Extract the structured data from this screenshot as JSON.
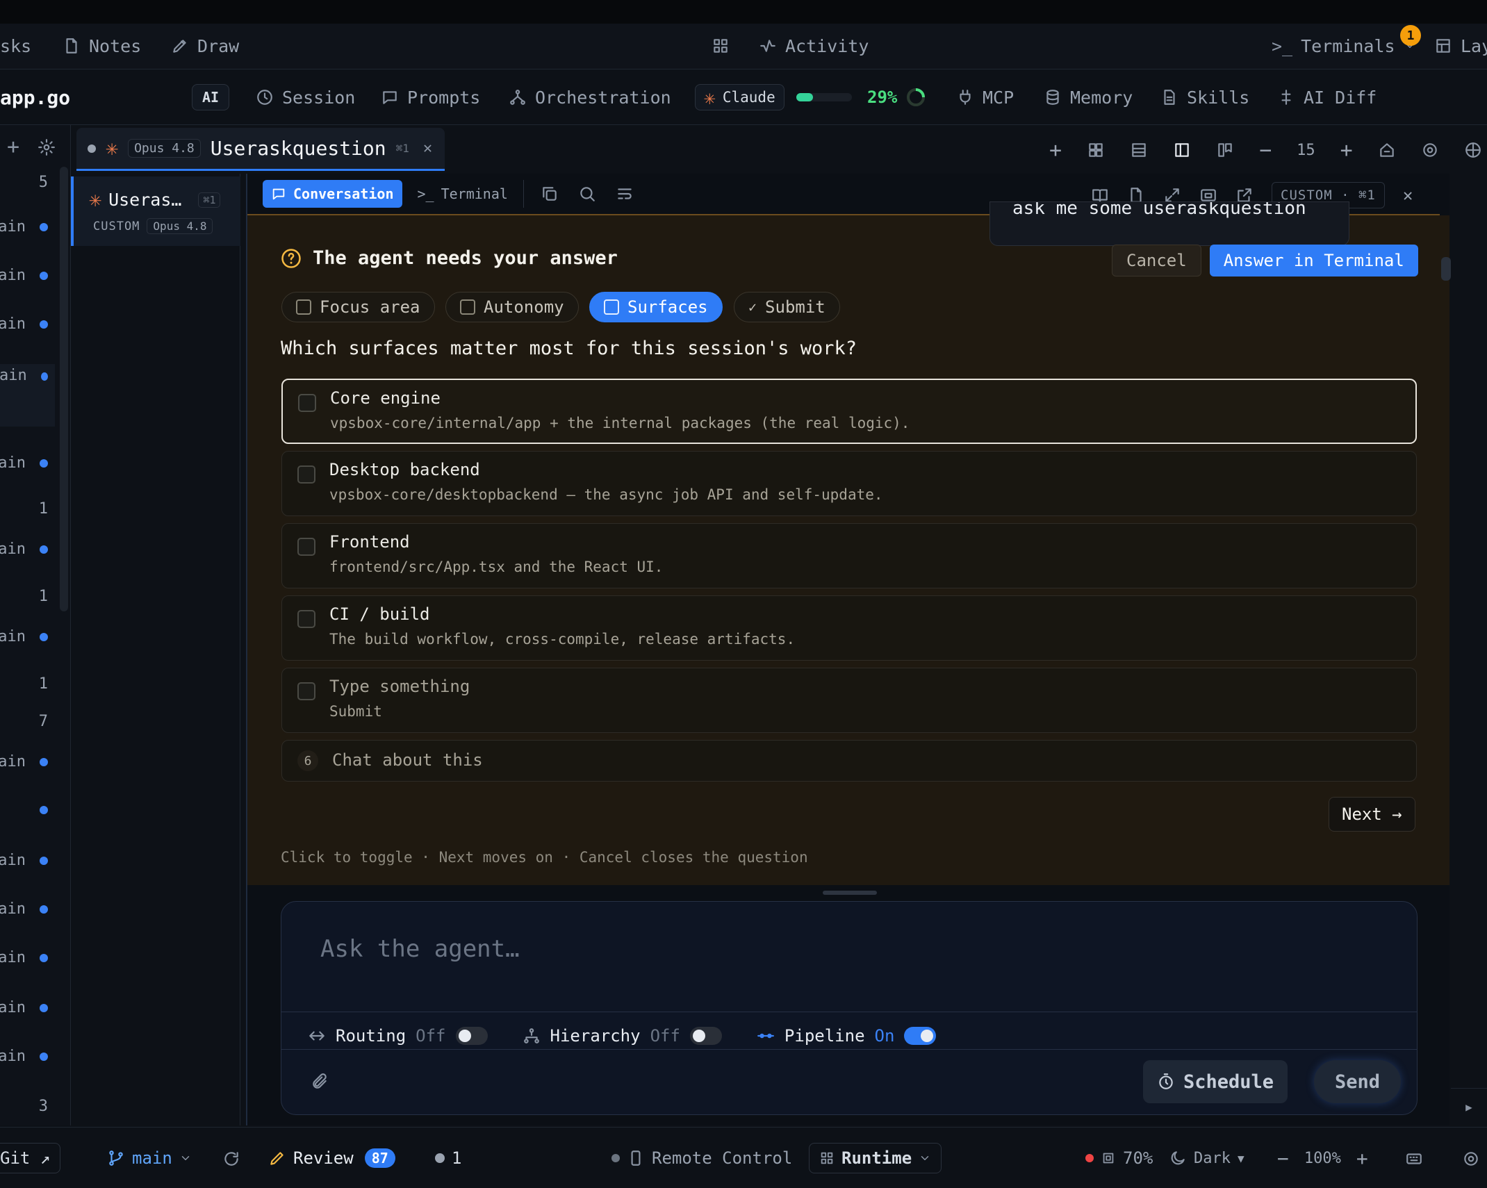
{
  "topnav": {
    "tasks": "sks",
    "notes": "Notes",
    "draw": "Draw",
    "activity": "Activity",
    "terminals": "Terminals",
    "terminals_badge": "1",
    "layout": "Lay"
  },
  "secbar": {
    "file": "app.go",
    "ai": "AI",
    "session": "Session",
    "prompts": "Prompts",
    "orchestration": "Orchestration",
    "claude": "Claude",
    "usage": "29%",
    "mcp": "MCP",
    "memory": "Memory",
    "skills": "Skills",
    "ai_diff": "AI Diff"
  },
  "tab": {
    "model": "Opus 4.8",
    "title": "Useraskquestion",
    "shortcut": "⌘1"
  },
  "toolbar": {
    "zoom": "15"
  },
  "session_card": {
    "title": "Useras…",
    "shortcut": "⌘1",
    "mode": "CUSTOM",
    "model": "Opus 4.8"
  },
  "leftstrip": [
    {
      "label": "5"
    },
    {
      "label": "ain"
    },
    {
      "label": "ain"
    },
    {
      "label": "ain"
    },
    {
      "label": "ain"
    },
    {
      "label": "ain"
    },
    {
      "label": "1"
    },
    {
      "label": "ain"
    },
    {
      "label": "1"
    },
    {
      "label": "ain"
    },
    {
      "label": "1"
    },
    {
      "label": "7"
    },
    {
      "label": "ain"
    },
    {
      "label": ""
    },
    {
      "label": "ain"
    },
    {
      "label": "ain"
    },
    {
      "label": "ain"
    },
    {
      "label": "ain"
    },
    {
      "label": "ain"
    },
    {
      "label": "3"
    }
  ],
  "panel_tabs": {
    "conversation": "Conversation",
    "terminal": "Terminal",
    "mode_label": "CUSTOM · ⌘1"
  },
  "prior_message": "ask me some useraskquestion",
  "question": {
    "heading": "The agent needs your answer",
    "cancel": "Cancel",
    "answer_terminal": "Answer in Terminal",
    "steps": [
      "Focus area",
      "Autonomy",
      "Surfaces",
      "Submit"
    ],
    "prompt": "Which surfaces matter most for this session's work?",
    "options": [
      {
        "title": "Core engine",
        "desc": "vpsbox-core/internal/app + the internal packages (the real logic)."
      },
      {
        "title": "Desktop backend",
        "desc": "vpsbox-core/desktopbackend — the async job API and self-update."
      },
      {
        "title": "Frontend",
        "desc": "frontend/src/App.tsx and the React UI."
      },
      {
        "title": "CI / build",
        "desc": "The build workflow, cross-compile, release artifacts."
      },
      {
        "title": "Type something",
        "desc": "Submit"
      }
    ],
    "chat_num": "6",
    "chat_label": "Chat about this",
    "next": "Next →",
    "hint": "Click to toggle · Next moves on · Cancel closes the question"
  },
  "composer": {
    "placeholder": "Ask the agent…",
    "routing": "Routing",
    "routing_state": "Off",
    "hierarchy": "Hierarchy",
    "hierarchy_state": "Off",
    "pipeline": "Pipeline",
    "pipeline_state": "On",
    "schedule": "Schedule",
    "send": "Send"
  },
  "statusbar": {
    "git": "Git ↗",
    "branch": "main",
    "review": "Review",
    "review_count": "87",
    "issues": "1",
    "remote": "Remote Control",
    "runtime": "Runtime",
    "cpu": "70%",
    "theme": "Dark",
    "zoom": "100%"
  },
  "colors": {
    "accent": "#2f7cf6",
    "green": "#4ade80",
    "orange": "#f59e0b",
    "panel_bg": "#1f1910"
  }
}
